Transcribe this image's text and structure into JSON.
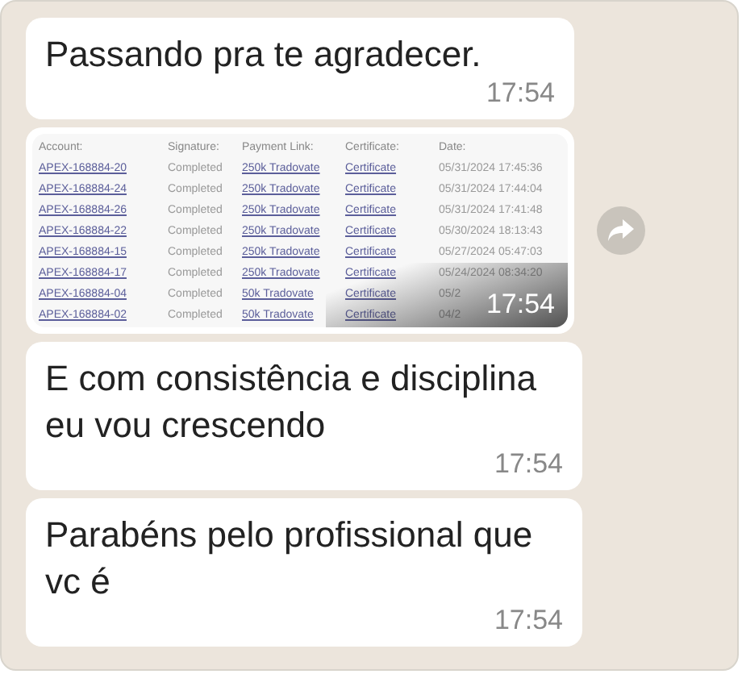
{
  "messages": [
    {
      "kind": "text",
      "text": "Passando pra te agradecer.",
      "time": "17:54"
    },
    {
      "kind": "table",
      "time": "17:54",
      "columns": [
        "Account:",
        "Signature:",
        "Payment Link:",
        "Certificate:",
        "Date:"
      ],
      "rows": [
        [
          "APEX-168884-20",
          "Completed",
          "250k Tradovate",
          "Certificate",
          "05/31/2024 17:45:36"
        ],
        [
          "APEX-168884-24",
          "Completed",
          "250k Tradovate",
          "Certificate",
          "05/31/2024 17:44:04"
        ],
        [
          "APEX-168884-26",
          "Completed",
          "250k Tradovate",
          "Certificate",
          "05/31/2024 17:41:48"
        ],
        [
          "APEX-168884-22",
          "Completed",
          "250k Tradovate",
          "Certificate",
          "05/30/2024 18:13:43"
        ],
        [
          "APEX-168884-15",
          "Completed",
          "250k Tradovate",
          "Certificate",
          "05/27/2024 05:47:03"
        ],
        [
          "APEX-168884-17",
          "Completed",
          "250k Tradovate",
          "Certificate",
          "05/24/2024 08:34:20"
        ],
        [
          "APEX-168884-04",
          "Completed",
          "50k Tradovate",
          "Certificate",
          "05/2"
        ],
        [
          "APEX-168884-02",
          "Completed",
          "50k Tradovate",
          "Certificate",
          "04/2"
        ]
      ]
    },
    {
      "kind": "text",
      "text": "E com consistência e disciplina eu vou crescendo",
      "time": "17:54"
    },
    {
      "kind": "text",
      "text": "Parabéns pelo profissional que vc é",
      "time": "17:54"
    }
  ]
}
